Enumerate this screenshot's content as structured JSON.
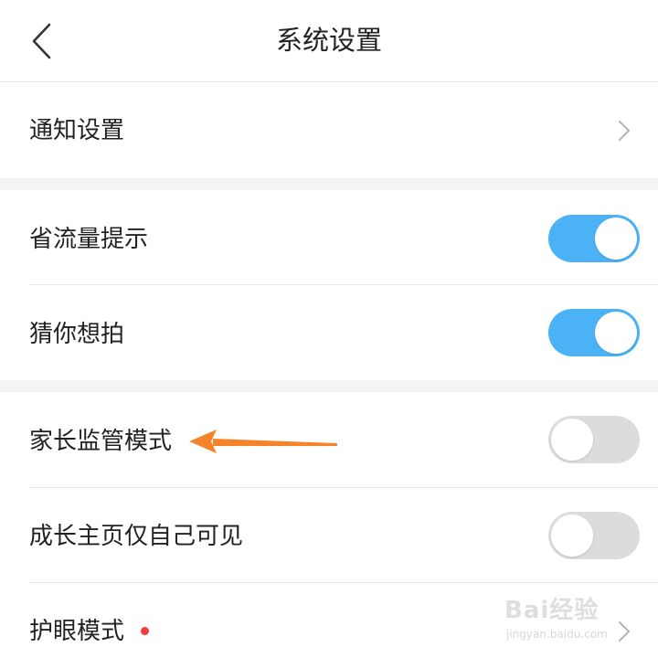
{
  "header": {
    "title": "系统设置",
    "back_icon": "chevron-left-icon"
  },
  "rows": [
    {
      "label": "通知设置",
      "control": "chevron-right-icon"
    },
    {
      "label": "省流量提示",
      "control": "toggle",
      "enabled": true
    },
    {
      "label": "猜你想拍",
      "control": "toggle",
      "enabled": true
    },
    {
      "label": "家长监管模式",
      "control": "toggle",
      "enabled": false
    },
    {
      "label": "成长主页仅自己可见",
      "control": "toggle",
      "enabled": false
    },
    {
      "label": "护眼模式",
      "control": "chevron-right-icon",
      "badge": "red-dot"
    }
  ],
  "annotation": {
    "icon": "orange-arrow-left-icon",
    "color": "#f5832a"
  },
  "watermark": {
    "brand": "Bai经验",
    "url": "jingyan.baidu.com"
  },
  "colors": {
    "toggle_on": "#4ab2f5",
    "toggle_off": "#dcdcdc",
    "badge": "#f23b3b",
    "section_gap": "#f4f4f4"
  }
}
